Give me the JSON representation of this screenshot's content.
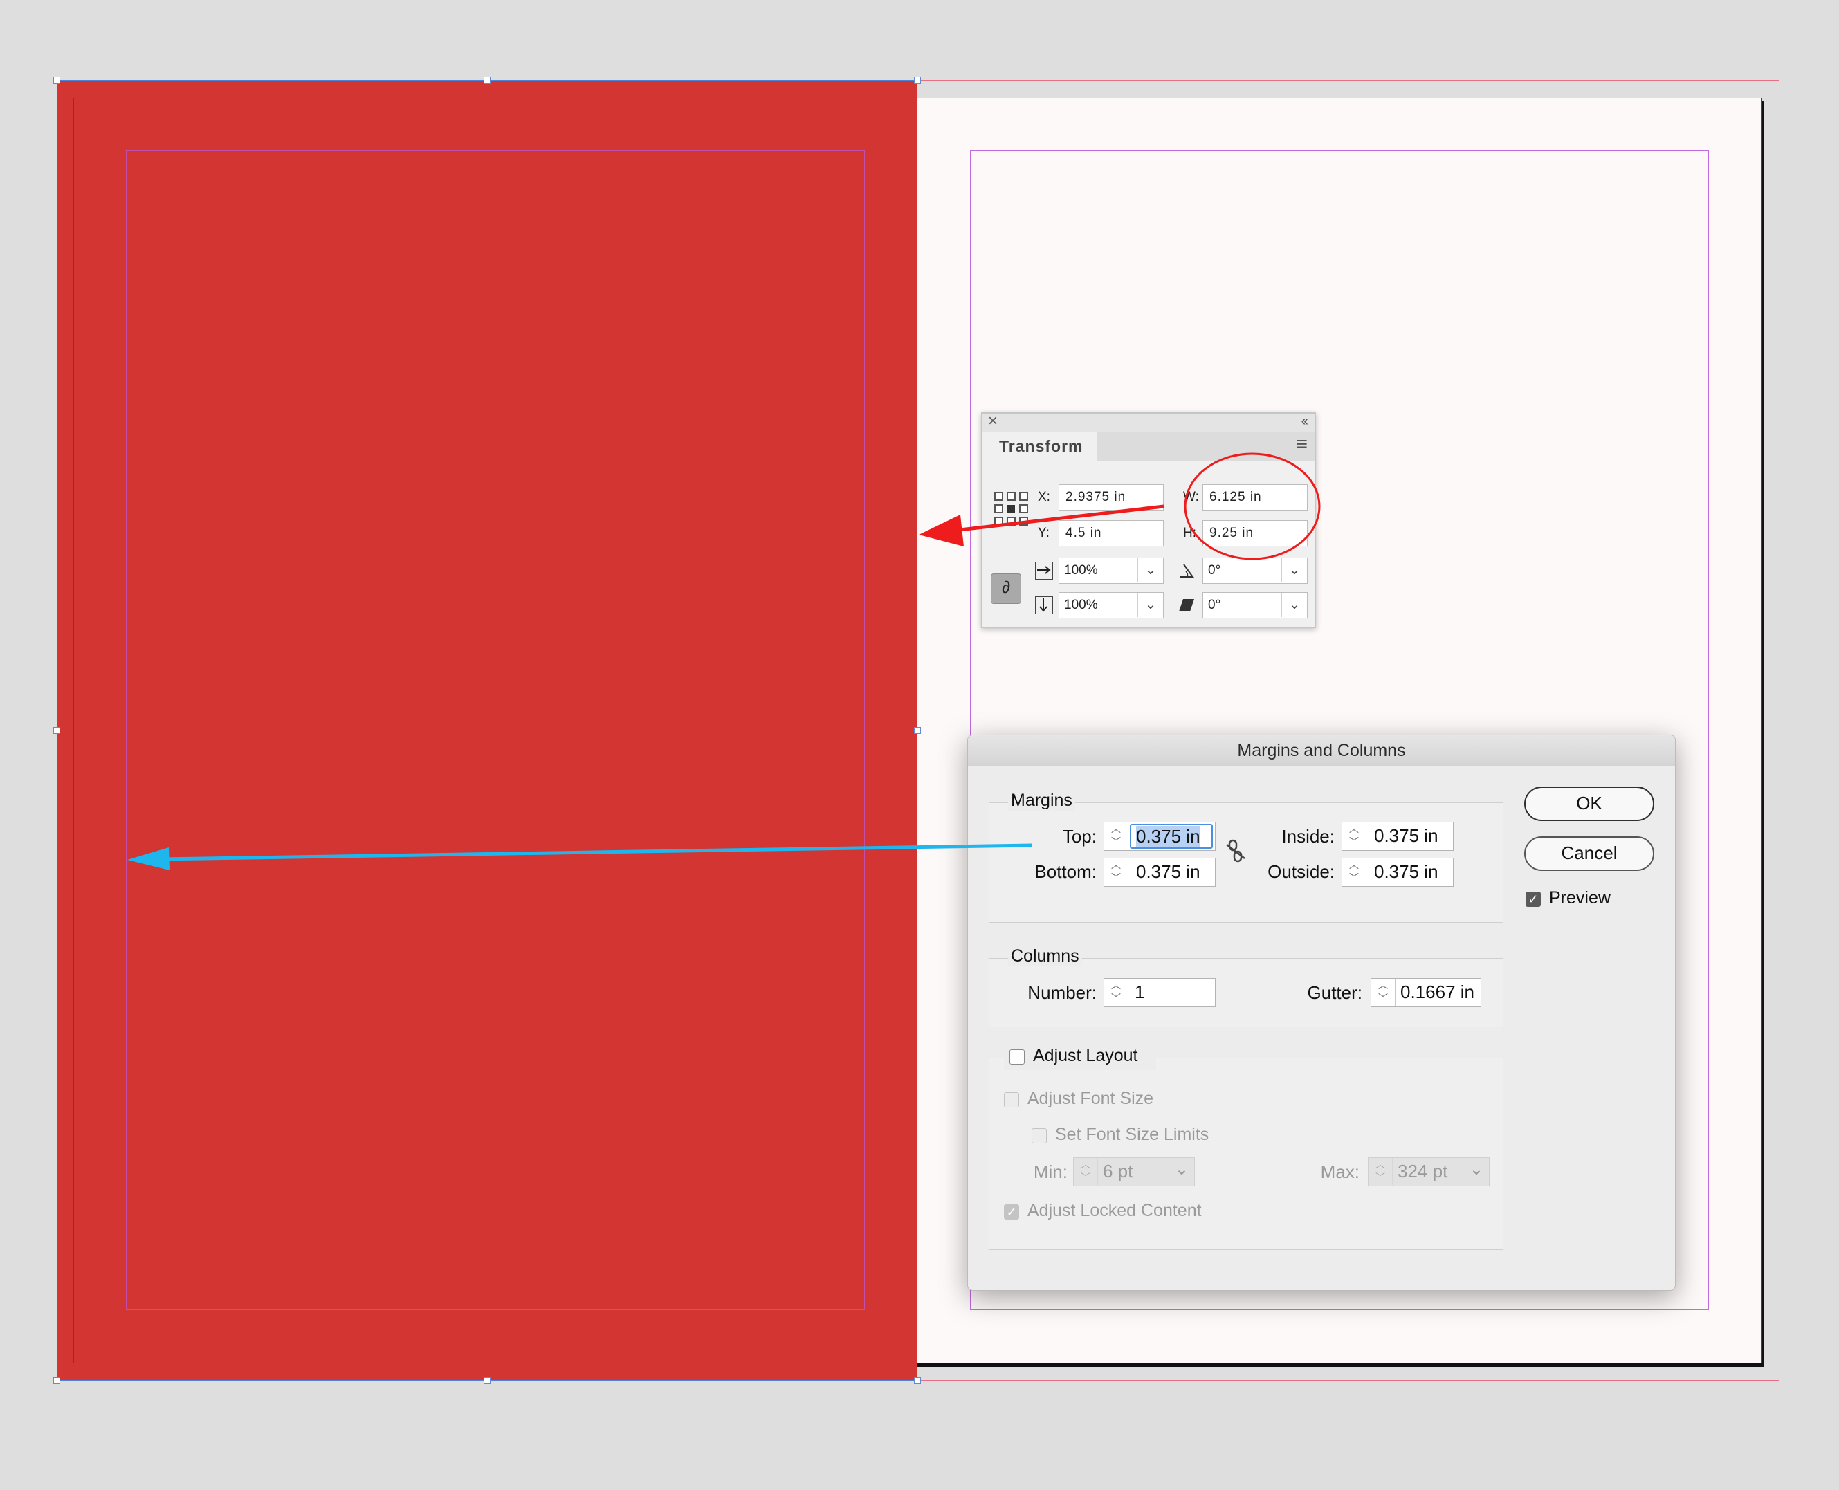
{
  "canvas": {
    "colors": {
      "pasteboard": "#dedede",
      "page": "#fdf9f8",
      "fill": "#d23532",
      "margin_guide": "#c26adf",
      "bleed_guide": "#e86e86",
      "annotation_red": "#ee1c1c",
      "annotation_blue": "#1fb6ee"
    }
  },
  "transform_panel": {
    "close_glyph": "×",
    "collapse_glyph": "‹‹",
    "tab_label": "Transform",
    "menu_glyph": "≡",
    "x_label": "X:",
    "x_value": "2.9375 in",
    "y_label": "Y:",
    "y_value": "4.5 in",
    "w_label": "W:",
    "w_value": "6.125 in",
    "h_label": "H:",
    "h_value": "9.25 in",
    "scale_x_value": "100%",
    "scale_y_value": "100%",
    "rotate_value": "0°",
    "shear_value": "0°",
    "link_glyph": "∂"
  },
  "margins_dialog": {
    "title": "Margins and Columns",
    "margins_group": "Margins",
    "top_label": "Top:",
    "top_value": "0.375 in",
    "bottom_label": "Bottom:",
    "bottom_value": "0.375 in",
    "inside_label": "Inside:",
    "inside_value": "0.375 in",
    "outside_label": "Outside:",
    "outside_value": "0.375 in",
    "columns_group": "Columns",
    "number_label": "Number:",
    "number_value": "1",
    "gutter_label": "Gutter:",
    "gutter_value": "0.1667 in",
    "adjust_layout_label": "Adjust Layout",
    "adjust_layout_checked": false,
    "adjust_font_size_label": "Adjust Font Size",
    "set_font_size_limits_label": "Set Font Size Limits",
    "min_label": "Min:",
    "min_value": "6 pt",
    "max_label": "Max:",
    "max_value": "324 pt",
    "adjust_locked_content_label": "Adjust Locked Content",
    "adjust_locked_content_checked": true,
    "ok_label": "OK",
    "cancel_label": "Cancel",
    "preview_label": "Preview",
    "preview_checked": true,
    "spin_up": "︿",
    "spin_down": "﹀",
    "checkmark": "✓",
    "dropdown_arrow": "⌄"
  }
}
